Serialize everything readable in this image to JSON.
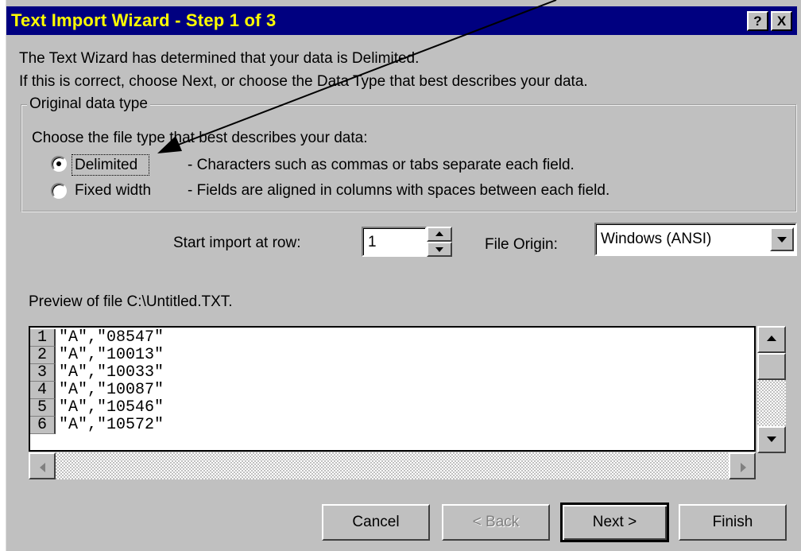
{
  "window": {
    "title": "Text Import Wizard - Step 1 of 3",
    "help_btn": "?",
    "close_btn": "X"
  },
  "intro": {
    "line1": "The Text Wizard has determined that your data is Delimited.",
    "line2": "If this is correct, choose Next, or choose the Data Type that best describes your data."
  },
  "group": {
    "legend": "Original data type",
    "prompt": "Choose the file type that best describes your data:",
    "options": [
      {
        "label": "Delimited",
        "desc": "- Characters such as commas or tabs separate each field.",
        "selected": true
      },
      {
        "label": "Fixed width",
        "desc": "- Fields are aligned in columns with spaces between each field.",
        "selected": false
      }
    ]
  },
  "start_row": {
    "label": "Start import at row:",
    "value": "1"
  },
  "file_origin": {
    "label": "File Origin:",
    "value": "Windows (ANSI)"
  },
  "preview": {
    "label": "Preview of file C:\\Untitled.TXT.",
    "rows": [
      {
        "num": "1",
        "text": "\"A\",\"08547\""
      },
      {
        "num": "2",
        "text": "\"A\",\"10013\""
      },
      {
        "num": "3",
        "text": "\"A\",\"10033\""
      },
      {
        "num": "4",
        "text": "\"A\",\"10087\""
      },
      {
        "num": "5",
        "text": "\"A\",\"10546\""
      },
      {
        "num": "6",
        "text": "\"A\",\"10572\""
      }
    ]
  },
  "buttons": {
    "cancel": "Cancel",
    "back": "< Back",
    "next": "Next >",
    "finish": "Finish"
  },
  "colors": {
    "titlebar": "#000080",
    "title_text": "#ffff00",
    "face": "#c0c0c0"
  },
  "annotation": {
    "arrow_icon": "arrow-pointer"
  }
}
